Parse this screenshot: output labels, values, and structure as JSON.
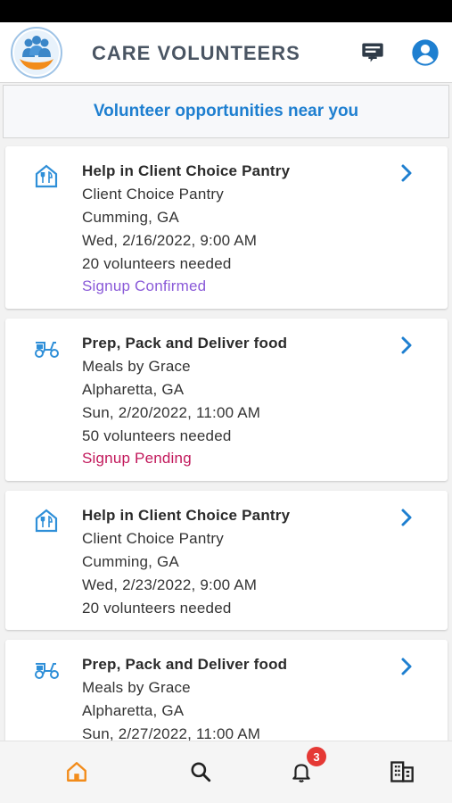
{
  "app": {
    "title": "CARE VOLUNTEERS"
  },
  "banner": {
    "text": "Volunteer opportunities near you"
  },
  "colors": {
    "accent": "#1e7fd0",
    "confirmed": "#8a5ad8",
    "pending": "#c2185b",
    "tab_active": "#f28c1b",
    "badge": "#e53935"
  },
  "opportunities": [
    {
      "icon": "pantry-icon",
      "title": "Help in Client Choice Pantry",
      "organization": " Client Choice Pantry",
      "location": "Cumming, GA",
      "datetime": "Wed, 2/16/2022,  9:00 AM",
      "needed": "20 volunteers needed",
      "status": "Signup Confirmed"
    },
    {
      "icon": "delivery-scooter-icon",
      "title": "Prep, Pack and Deliver food",
      "organization": "Meals by Grace",
      "location": "Alpharetta, GA",
      "datetime": "Sun, 2/20/2022,  11:00 AM",
      "needed": "50 volunteers needed",
      "status": "Signup Pending"
    },
    {
      "icon": "pantry-icon",
      "title": "Help in Client Choice Pantry",
      "organization": "Client Choice Pantry",
      "location": "Cumming, GA",
      "datetime": "Wed, 2/23/2022,  9:00 AM",
      "needed": "20 volunteers needed"
    },
    {
      "icon": "delivery-scooter-icon",
      "title": "Prep, Pack and Deliver food",
      "organization": "Meals by Grace",
      "location": "Alpharetta, GA",
      "datetime": "Sun, 2/27/2022,  11:00 AM"
    }
  ],
  "tabbar": {
    "tabs": [
      {
        "name": "home-icon",
        "active": true
      },
      {
        "name": "search-icon",
        "active": false
      },
      {
        "name": "bell-icon",
        "active": false
      },
      {
        "name": "organizations-icon",
        "active": false
      }
    ],
    "notification_count": "3"
  }
}
